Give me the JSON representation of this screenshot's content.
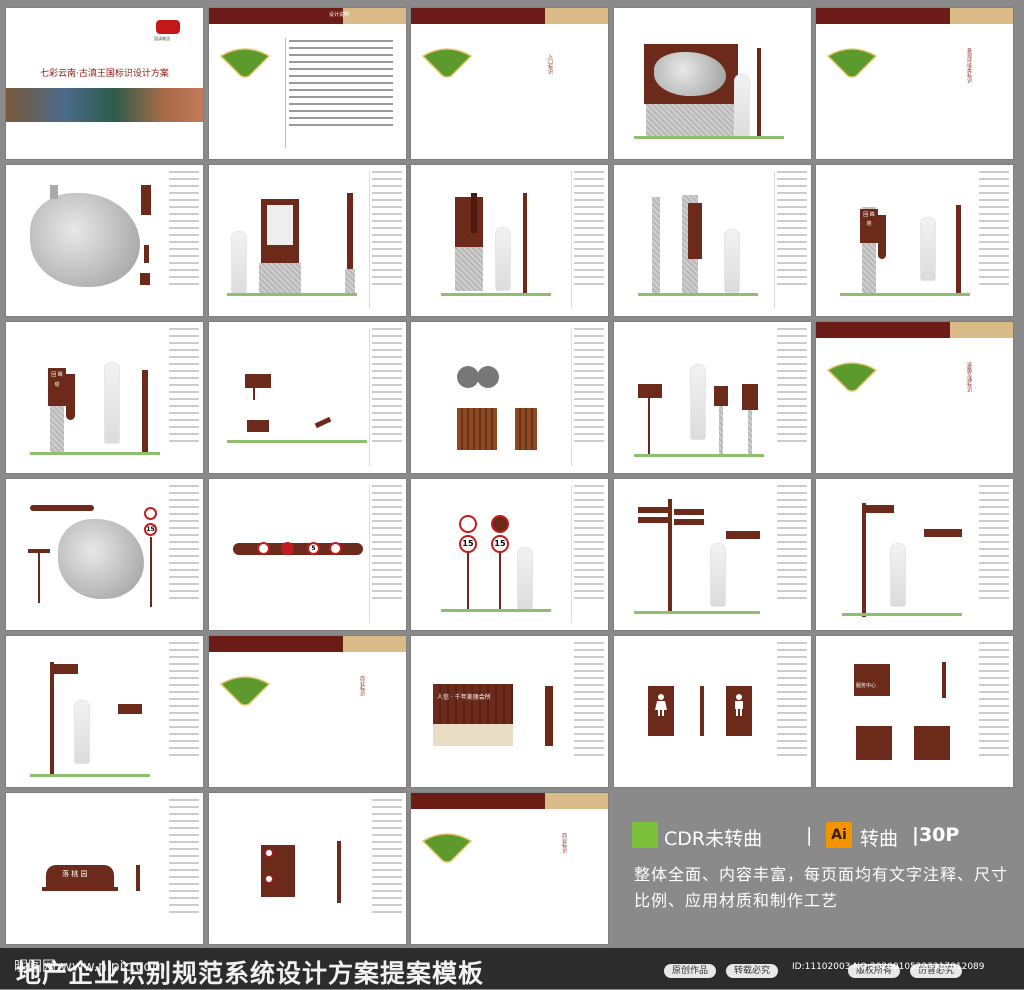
{
  "cover": {
    "title": "七彩云南·古滇王国标识设计方案",
    "logo_text": "国滇集团"
  },
  "pages": {
    "p2_heading": "设计说明",
    "p_section_entrance": "入口标识",
    "p_section_scenic": "景观环境类标识",
    "p_section_road": "道路交通标识",
    "p_section_business": "商业标识",
    "p_section_commerce": "商业标识",
    "sign_huanluo": "回 眸 塔",
    "sign_hall": "人信 · 千年美丽会所",
    "sign_pool": "落 桃 园",
    "sign_center": "服务中心",
    "speed_15": "15",
    "speed_5": "5"
  },
  "features": {
    "cdr_label": "CDR未转曲",
    "divider": "|",
    "ai_badge": "Ai",
    "ai_label": "转曲",
    "pages_count": "|30P",
    "desc": "整体全面、内容丰富，每页面均有文字注释、尺寸比例、应用材质和制作工艺"
  },
  "footer": {
    "title": "地产企业识别规范系统设计方案提案模板",
    "watermark": "昵图网 www.nipic.com",
    "btn1": "原创作品",
    "btn2": "转载必究",
    "btn3": "版权所有",
    "btn4": "仿冒必究",
    "id_text": "ID:11102003 NO:20200105223317012089"
  },
  "colors": {
    "brand": "#6b1c16",
    "accent": "#d9bb88",
    "green": "#8fbf6e"
  }
}
